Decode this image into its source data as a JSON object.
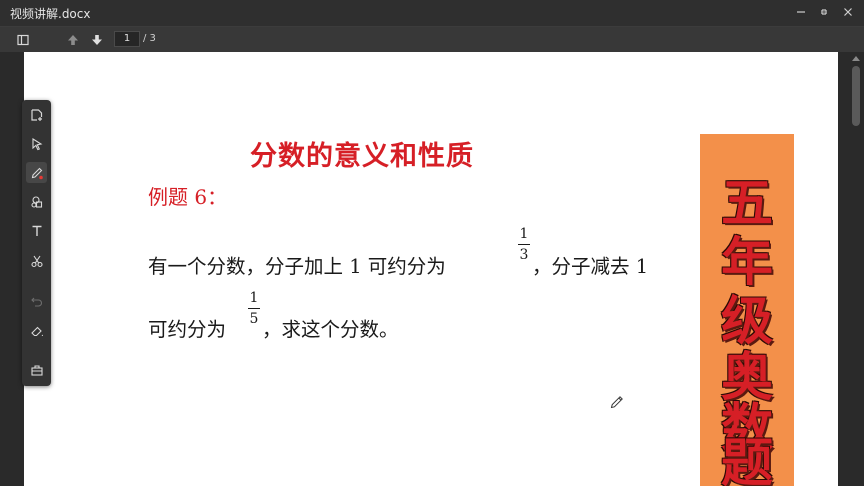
{
  "window": {
    "title": "视频讲解.docx",
    "controls": [
      "minimize-icon",
      "restore-icon",
      "close-icon"
    ]
  },
  "toolbar": {
    "page_current": "1",
    "page_total": "/ 3",
    "icons": [
      "sidebar-toggle-icon",
      "arrow-up-icon",
      "arrow-down-icon"
    ]
  },
  "palette": {
    "tools": [
      "add-page-icon",
      "pointer-icon",
      "pen-icon",
      "shapes-icon",
      "text-icon",
      "scissors-icon",
      "undo-icon",
      "eraser-icon",
      "toolbox-icon"
    ],
    "active_tool": "pen-icon",
    "disabled_tool": "undo-icon",
    "pen_dot_color": "#e53935"
  },
  "document": {
    "title": "分数的意义和性质",
    "example_label": "例题 6：",
    "line1_part1": "有一个分数，分子加上 1 可约分为",
    "line1_frac_num": "1",
    "line1_frac_den": "3",
    "line1_part2": "，分子减去 1",
    "line2_part1": "可约分为",
    "line2_frac_num": "1",
    "line2_frac_den": "5",
    "line2_part2": "，求这个分数。",
    "title_color": "#d61f26"
  },
  "banner": {
    "chars": [
      "五",
      "年",
      "级",
      "奥",
      "数",
      "题"
    ],
    "background": "#f3904a",
    "text_color": "#d61f26"
  }
}
